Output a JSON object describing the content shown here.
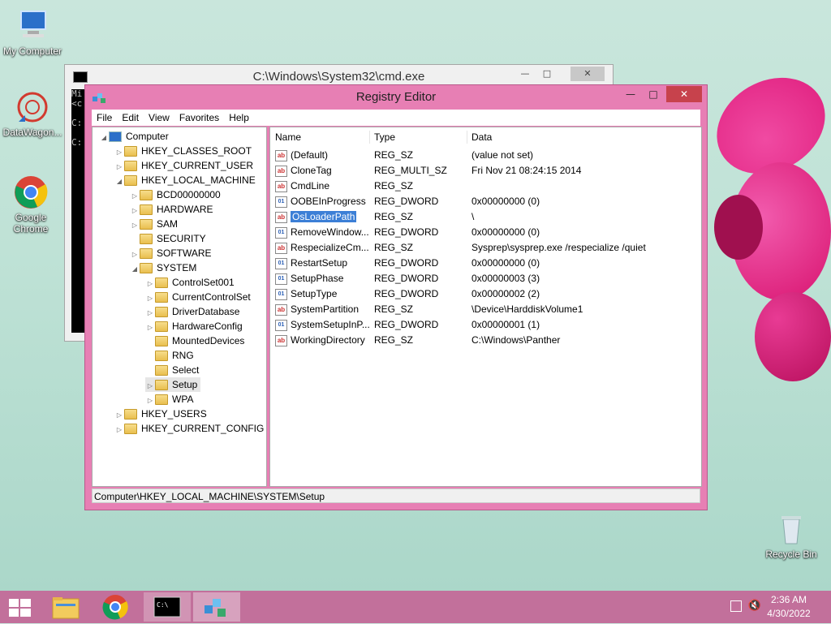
{
  "desktop": {
    "icons": [
      {
        "label": "My Computer"
      },
      {
        "label": "DataWagon..."
      },
      {
        "label": "Google Chrome"
      },
      {
        "label": "Recycle Bin"
      }
    ]
  },
  "cmd_window": {
    "title": "C:\\Windows\\System32\\cmd.exe",
    "console_lines": [
      "Mi",
      "<c",
      "",
      "C:",
      "",
      "C:"
    ]
  },
  "regedit": {
    "title": "Registry Editor",
    "menu": [
      "File",
      "Edit",
      "View",
      "Favorites",
      "Help"
    ],
    "tree": [
      {
        "label": "Computer"
      },
      {
        "label": "HKEY_CLASSES_ROOT"
      },
      {
        "label": "HKEY_CURRENT_USER"
      },
      {
        "label": "HKEY_LOCAL_MACHINE"
      },
      {
        "label": "BCD00000000"
      },
      {
        "label": "HARDWARE"
      },
      {
        "label": "SAM"
      },
      {
        "label": "SECURITY"
      },
      {
        "label": "SOFTWARE"
      },
      {
        "label": "SYSTEM"
      },
      {
        "label": "ControlSet001"
      },
      {
        "label": "CurrentControlSet"
      },
      {
        "label": "DriverDatabase"
      },
      {
        "label": "HardwareConfig"
      },
      {
        "label": "MountedDevices"
      },
      {
        "label": "RNG"
      },
      {
        "label": "Select"
      },
      {
        "label": "Setup"
      },
      {
        "label": "WPA"
      },
      {
        "label": "HKEY_USERS"
      },
      {
        "label": "HKEY_CURRENT_CONFIG"
      }
    ],
    "columns": {
      "name": "Name",
      "type": "Type",
      "data": "Data"
    },
    "values": [
      {
        "name": "(Default)",
        "type": "REG_SZ",
        "data": "(value not set)",
        "icon": "ab"
      },
      {
        "name": "CloneTag",
        "type": "REG_MULTI_SZ",
        "data": "Fri Nov 21 08:24:15 2014",
        "icon": "ab"
      },
      {
        "name": "CmdLine",
        "type": "REG_SZ",
        "data": "",
        "icon": "ab"
      },
      {
        "name": "OOBEInProgress",
        "type": "REG_DWORD",
        "data": "0x00000000 (0)",
        "icon": "bin"
      },
      {
        "name": "OsLoaderPath",
        "type": "REG_SZ",
        "data": "\\",
        "icon": "ab"
      },
      {
        "name": "RemoveWindow...",
        "type": "REG_DWORD",
        "data": "0x00000000 (0)",
        "icon": "bin"
      },
      {
        "name": "RespecializeCm...",
        "type": "REG_SZ",
        "data": "Sysprep\\sysprep.exe /respecialize /quiet",
        "icon": "ab"
      },
      {
        "name": "RestartSetup",
        "type": "REG_DWORD",
        "data": "0x00000000 (0)",
        "icon": "bin"
      },
      {
        "name": "SetupPhase",
        "type": "REG_DWORD",
        "data": "0x00000003 (3)",
        "icon": "bin"
      },
      {
        "name": "SetupType",
        "type": "REG_DWORD",
        "data": "0x00000002 (2)",
        "icon": "bin"
      },
      {
        "name": "SystemPartition",
        "type": "REG_SZ",
        "data": "\\Device\\HarddiskVolume1",
        "icon": "ab"
      },
      {
        "name": "SystemSetupInP...",
        "type": "REG_DWORD",
        "data": "0x00000001 (1)",
        "icon": "bin"
      },
      {
        "name": "WorkingDirectory",
        "type": "REG_SZ",
        "data": "C:\\Windows\\Panther",
        "icon": "ab"
      }
    ],
    "status_path": "Computer\\HKEY_LOCAL_MACHINE\\SYSTEM\\Setup"
  },
  "taskbar": {
    "time": "2:36 AM",
    "date": "4/30/2022"
  }
}
